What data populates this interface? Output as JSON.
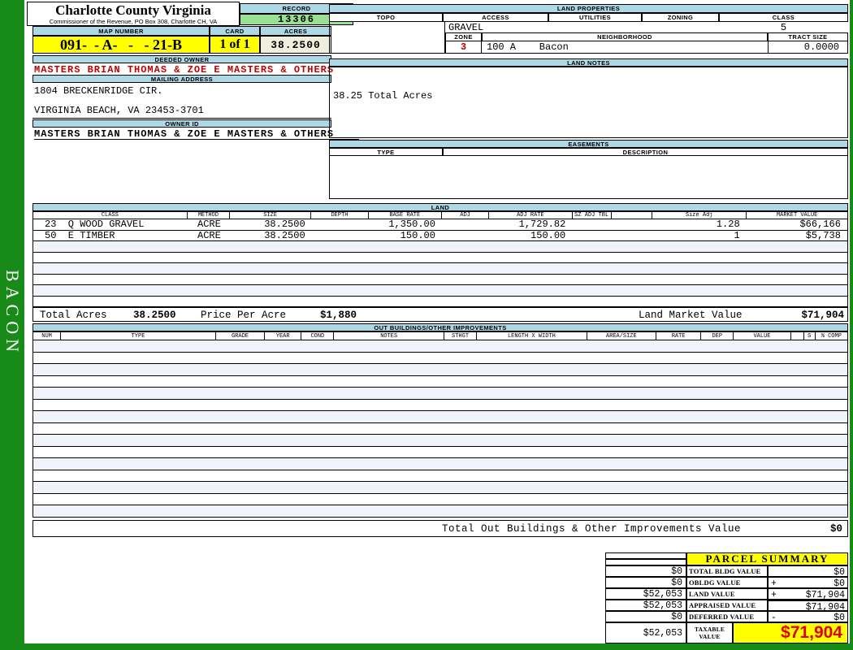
{
  "sidebar": {
    "label": "BACON"
  },
  "header": {
    "county_title": "Charlotte County Virginia",
    "county_subtitle": "Commissioner of the Revenue, PO Box 308, Charlotte CH, VA",
    "record_label": "RECORD",
    "record_value": "13306",
    "map_number_label": "MAP NUMBER",
    "map_number_value": "091-  - A-   -   - 21-B",
    "card_label": "CARD",
    "card_value": "1 of 1",
    "acres_label": "ACRES",
    "acres_value": "38.2500"
  },
  "owner": {
    "deeded_owner_label": "DEEDED OWNER",
    "deeded_owner_value": "MASTERS BRIAN THOMAS & ZOE E MASTERS & OTHERS",
    "mailing_address_label": "MAILING ADDRESS",
    "mailing_address_line1": "1804 BRECKENRIDGE CIR.",
    "mailing_address_line2": "VIRGINIA BEACH, VA 23453-3701",
    "owner_id_label": "OWNER ID",
    "owner_id_value": "MASTERS BRIAN THOMAS & ZOE E MASTERS & OTHERS"
  },
  "land_properties": {
    "section_label": "LAND PROPERTIES",
    "topo_label": "TOPO",
    "access_label": "ACCESS",
    "access_value": "GRAVEL",
    "utilities_label": "UTILITIES",
    "zoning_label": "ZONING",
    "class_label": "CLASS",
    "class_value": "5",
    "zone_label": "ZONE",
    "zone_value": "3",
    "neighborhood_label": "NEIGHBORHOOD",
    "neighborhood_value": "100 A    Bacon",
    "tract_size_label": "TRACT SIZE",
    "tract_size_value": "0.0000"
  },
  "land_notes": {
    "section_label": "LAND NOTES",
    "note": "38.25 Total Acres"
  },
  "easements": {
    "section_label": "EASEMENTS",
    "type_label": "TYPE",
    "description_label": "DESCRIPTION"
  },
  "land_table": {
    "section_label": "LAND",
    "headers": [
      "CLASS",
      "METHOD",
      "SIZE",
      "DEPTH",
      "BASE RATE",
      "ADJ",
      "ADJ RATE",
      "SZ ADJ TBL",
      "",
      "Size Adj",
      "MARKET VALUE"
    ],
    "rows": [
      [
        "23  Q WOOD GRAVEL",
        "ACRE",
        "38.2500",
        "",
        "1,350.00",
        "",
        "1,729.82",
        "",
        "",
        "1.28",
        "$66,166"
      ],
      [
        "50  E TIMBER",
        "ACRE",
        "38.2500",
        "",
        "150.00",
        "",
        "150.00",
        "",
        "",
        "1",
        "$5,738"
      ]
    ],
    "totals": {
      "total_acres_label": "Total Acres",
      "total_acres_value": "38.2500",
      "price_per_acre_label": "Price Per Acre",
      "price_per_acre_value": "$1,880",
      "land_market_value_label": "Land Market Value",
      "land_market_value": "$71,904"
    }
  },
  "out_buildings": {
    "section_label": "OUT BUILDINGS/OTHER IMPROVEMENTS",
    "headers": [
      "NUM",
      "TYPE",
      "GRADE",
      "YEAR",
      "COND",
      "NOTES",
      "STHGT",
      "LENGTH X WIDTH",
      "AREA/SIZE",
      "RATE",
      "DEP",
      "VALUE",
      "",
      "S",
      "% COMP"
    ],
    "total_label": "Total Out Buildings & Other Improvements Value",
    "total_value": "$0"
  },
  "parcel_summary": {
    "title": "PARCEL SUMMARY",
    "rows": [
      {
        "prior": "$0",
        "label": "TOTAL BLDG VALUE",
        "op": "",
        "value": "$0"
      },
      {
        "prior": "$0",
        "label": "OBLDG VALUE",
        "op": "+",
        "value": "$0"
      },
      {
        "prior": "$52,053",
        "label": "LAND VALUE",
        "op": "+",
        "value": "$71,904"
      },
      {
        "prior": "$52,053",
        "label": "APPRAISED VALUE",
        "op": "",
        "value": "$71,904"
      },
      {
        "prior": "$0",
        "label": "DEFERRED VALUE",
        "op": "-",
        "value": "$0"
      }
    ],
    "taxable": {
      "prior": "$52,053",
      "label": "TAXABLE VALUE",
      "value": "$71,904"
    }
  },
  "colors": {
    "page_green": "#188A18",
    "section_header_blue": "#ADD8E6",
    "record_green": "#98E093",
    "highlight_yellow": "#FFFF00",
    "acres_cream": "#F0EFDE",
    "owner_red": "#C00000",
    "summary_value_red": "#E00000",
    "row_stripe": "#F0F3FA"
  }
}
